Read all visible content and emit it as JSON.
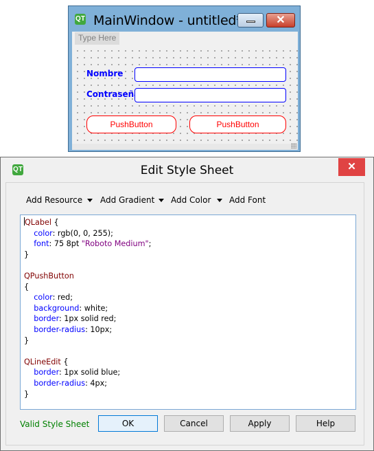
{
  "main_window": {
    "logo": "QT",
    "title": "MainWindow - untitled*",
    "menubar_placeholder": "Type Here",
    "form": {
      "nombre_label": "Nombre",
      "contrasena_label": "Contraseña",
      "button1_label": "PushButton",
      "button2_label": "PushButton"
    }
  },
  "dialog": {
    "logo": "QT",
    "title": "Edit Style Sheet",
    "close_glyph": "✕",
    "toolbar": {
      "add_resource": "Add Resource",
      "add_gradient": "Add Gradient",
      "add_color": "Add Color",
      "add_font": "Add Font"
    },
    "code": [
      [
        [
          "sel",
          "QLabel"
        ],
        [
          "brace",
          " {"
        ]
      ],
      [
        [
          "val",
          "    "
        ],
        [
          "prop",
          "color"
        ],
        [
          "val",
          ": rgb(0, 0, 255);"
        ]
      ],
      [
        [
          "val",
          "    "
        ],
        [
          "prop",
          "font"
        ],
        [
          "val",
          ": 75 8pt "
        ],
        [
          "str",
          "\"Roboto Medium\""
        ],
        [
          "val",
          ";"
        ]
      ],
      [
        [
          "brace",
          "}"
        ]
      ],
      [
        [
          "val",
          ""
        ]
      ],
      [
        [
          "sel",
          "QPushButton"
        ]
      ],
      [
        [
          "brace",
          "{"
        ]
      ],
      [
        [
          "val",
          "    "
        ],
        [
          "prop",
          "color"
        ],
        [
          "val",
          ": red;"
        ]
      ],
      [
        [
          "val",
          "    "
        ],
        [
          "prop",
          "background"
        ],
        [
          "val",
          ": white;"
        ]
      ],
      [
        [
          "val",
          "    "
        ],
        [
          "prop",
          "border"
        ],
        [
          "val",
          ": 1px solid red;"
        ]
      ],
      [
        [
          "val",
          "    "
        ],
        [
          "prop",
          "border-radius"
        ],
        [
          "val",
          ": 10px;"
        ]
      ],
      [
        [
          "brace",
          "}"
        ]
      ],
      [
        [
          "val",
          ""
        ]
      ],
      [
        [
          "sel",
          "QLineEdit"
        ],
        [
          "brace",
          " {"
        ]
      ],
      [
        [
          "val",
          "    "
        ],
        [
          "prop",
          "border"
        ],
        [
          "val",
          ": 1px solid blue;"
        ]
      ],
      [
        [
          "val",
          "    "
        ],
        [
          "prop",
          "border-radius"
        ],
        [
          "val",
          ": 4px;"
        ]
      ],
      [
        [
          "brace",
          "}"
        ]
      ]
    ],
    "status": "Valid Style Sheet",
    "buttons": {
      "ok": "OK",
      "cancel": "Cancel",
      "apply": "Apply",
      "help": "Help"
    }
  },
  "colors": {
    "label_blue": "#0000ff",
    "button_red": "#ff0000",
    "status_green": "#008000",
    "close_red": "#e04343"
  }
}
